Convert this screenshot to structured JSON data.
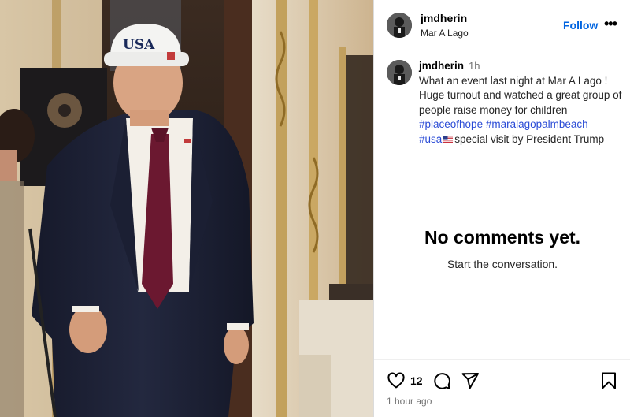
{
  "post": {
    "username": "jmdherin",
    "location": "Mar A Lago",
    "follow_label": "Follow",
    "more_label": "•••",
    "hat_text": "USA"
  },
  "caption": {
    "username": "jmdherin",
    "time": "1h",
    "text_line": "What an event last night at Mar A Lago ! Huge turnout and watched a great group of people raise money for children",
    "hashtags": [
      "#placeofhope",
      "#maralagopalmbeach",
      "#usa"
    ],
    "flag_icon": "us-flag-emoji",
    "text_tail": "special visit by President Trump"
  },
  "comments": {
    "empty_title": "No comments yet.",
    "empty_subtitle": "Start the conversation."
  },
  "actions": {
    "likes": "12",
    "posted": "1 hour ago",
    "icons": [
      "heart-icon",
      "comment-icon",
      "share-icon",
      "bookmark-icon"
    ]
  },
  "colors": {
    "link": "#0064e0",
    "hashtag": "#2a4bd6",
    "muted": "#737373"
  }
}
